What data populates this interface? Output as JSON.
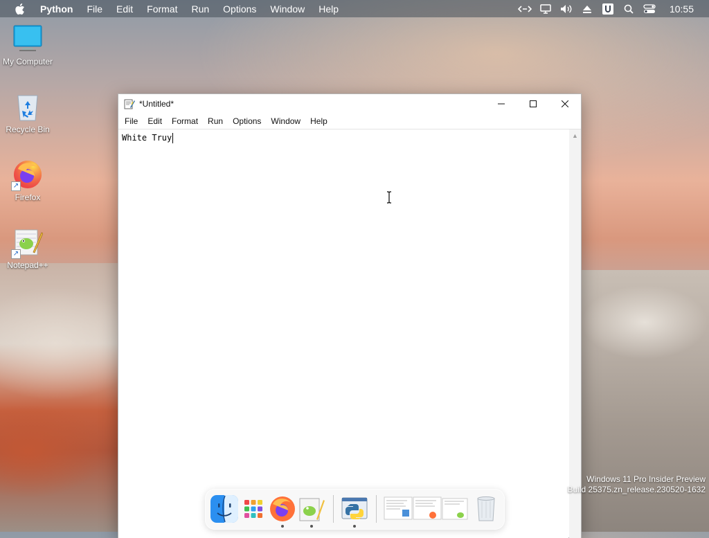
{
  "menubar": {
    "app_name": "Python",
    "items": [
      "File",
      "Edit",
      "Format",
      "Run",
      "Options",
      "Window",
      "Help"
    ],
    "clock": "10:55",
    "status_icons": [
      "code-brackets-icon",
      "display-icon",
      "volume-icon",
      "eject-icon",
      "u-badge-icon",
      "search-icon",
      "control-center-icon"
    ]
  },
  "desktop": {
    "icons": [
      {
        "label": "My Computer",
        "icon": "monitor-icon"
      },
      {
        "label": "Recycle Bin",
        "icon": "recycle-bin-icon"
      },
      {
        "label": "Firefox",
        "icon": "firefox-icon"
      },
      {
        "label": "Notepad++",
        "icon": "notepadpp-icon"
      }
    ]
  },
  "window": {
    "title": "*Untitled*",
    "menu": [
      "File",
      "Edit",
      "Format",
      "Run",
      "Options",
      "Window",
      "Help"
    ],
    "editor_text": "White Truy"
  },
  "watermark": {
    "line1": "Windows 11 Pro Insider Preview",
    "line2": "Build 25375.zn_release.230520-1632"
  },
  "dock": {
    "apps": [
      "finder-icon",
      "launchpad-icon",
      "firefox-icon",
      "notepadpp-icon",
      "python-idle-icon",
      "window-preview-icon",
      "trash-icon"
    ]
  },
  "colors": {
    "menubar_bg": "#464e58",
    "accent_blue": "#1b63c6"
  }
}
